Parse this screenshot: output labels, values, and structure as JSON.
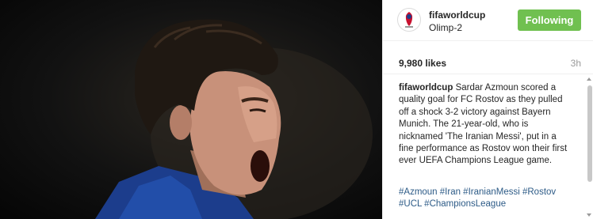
{
  "post": {
    "username": "fifaworldcup",
    "location": "Olimp-2",
    "follow_label": "Following",
    "likes": "9,980 likes",
    "time": "3h",
    "caption_author": "fifaworldcup",
    "caption_text": "Sardar Azmoun scored a quality goal for FC Rostov as they pulled off a shock 3-2 victory against Bayern Munich. The 21-year-old, who is nicknamed 'The Iranian Messi', put in a fine performance as Rostov won their first ever UEFA Champions League game.",
    "hashtags": "#Azmoun #Iran #IranianMessi #Rostov #UCL #ChampionsLeague"
  },
  "colors": {
    "follow_button": "#70c050",
    "hashtag": "#2d5b87",
    "text": "#262626",
    "muted": "#999999"
  },
  "icons": {
    "avatar": "fifa-world-cup-logo-icon"
  }
}
